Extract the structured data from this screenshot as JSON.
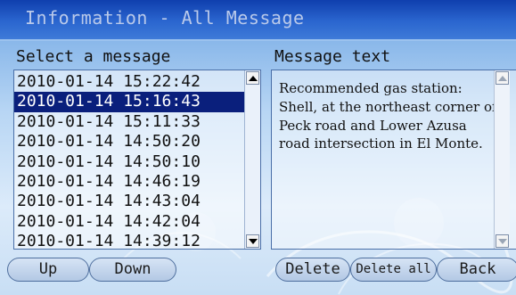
{
  "window": {
    "title": "Information - All Message"
  },
  "list": {
    "label": "Select a message",
    "items": [
      "2010-01-14 15:22:42",
      "2010-01-14 15:16:43",
      "2010-01-14 15:11:33",
      "2010-01-14 14:50:20",
      "2010-01-14 14:50:10",
      "2010-01-14 14:46:19",
      "2010-01-14 14:43:04",
      "2010-01-14 14:42:04",
      "2010-01-14 14:39:12"
    ],
    "selected_index": 1
  },
  "message": {
    "label": "Message text",
    "body": "Recommended gas station: Shell, at the northeast corner of Peck road and Lower Azusa road intersection in El Monte."
  },
  "buttons": {
    "up": "Up",
    "down": "Down",
    "delete": "Delete",
    "delete_all": "Delete all",
    "back": "Back"
  },
  "colors": {
    "title_bar": "#1d54c0",
    "selection": "#0a1f7c"
  },
  "icons": {
    "scroll_up": "triangle-up-icon",
    "scroll_down": "triangle-down-icon"
  }
}
